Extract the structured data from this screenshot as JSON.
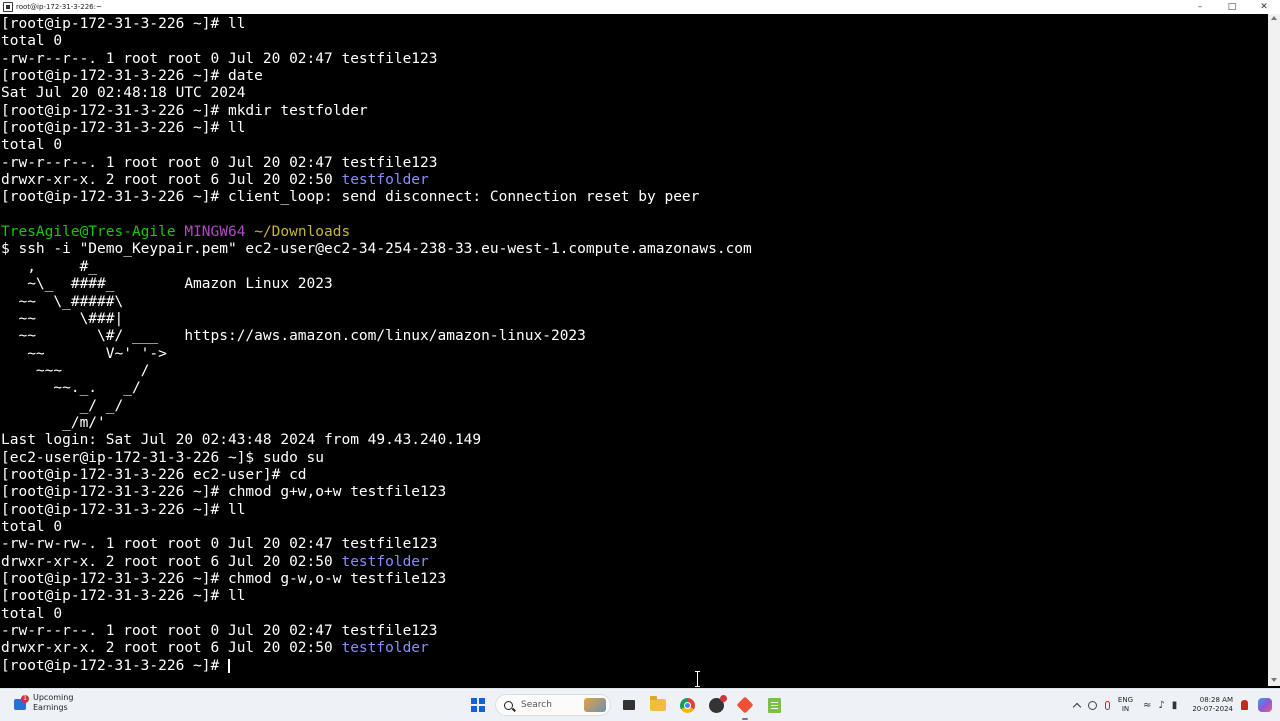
{
  "window": {
    "title": "root@ip-172-31-3-226:~"
  },
  "terminal": {
    "lines": [
      "[root@ip-172-31-3-226 ~]# ll",
      "total 0",
      "-rw-r--r--. 1 root root 0 Jul 20 02:47 testfile123",
      "[root@ip-172-31-3-226 ~]# date",
      "Sat Jul 20 02:48:18 UTC 2024",
      "[root@ip-172-31-3-226 ~]# mkdir testfolder",
      "[root@ip-172-31-3-226 ~]# ll",
      "total 0",
      "-rw-r--r--. 1 root root 0 Jul 20 02:47 testfile123",
      "drwxr-xr-x. 2 root root 6 Jul 20 02:50 ",
      "[root@ip-172-31-3-226 ~]# client_loop: send disconnect: Connection reset by peer",
      "",
      "TresAgile@Tres-Agile",
      "$ ssh -i \"Demo_Keypair.pem\" ec2-user@ec2-34-254-238-33.eu-west-1.compute.amazonaws.com",
      "   ,     #_",
      "   ~\\_  ####_        Amazon Linux 2023",
      "  ~~  \\_#####\\",
      "  ~~     \\###|",
      "  ~~       \\#/ ___   https://aws.amazon.com/linux/amazon-linux-2023",
      "   ~~       V~' '->",
      "    ~~~         /",
      "      ~~._.   _/",
      "         _/ _/",
      "       _/m/'",
      "Last login: Sat Jul 20 02:43:48 2024 from 49.43.240.149",
      "[ec2-user@ip-172-31-3-226 ~]$ sudo su",
      "[root@ip-172-31-3-226 ec2-user]# cd",
      "[root@ip-172-31-3-226 ~]# chmod g+w,o+w testfile123",
      "[root@ip-172-31-3-226 ~]# ll",
      "total 0",
      "-rw-rw-rw-. 1 root root 0 Jul 20 02:47 testfile123",
      "drwxr-xr-x. 2 root root 6 Jul 20 02:50 ",
      "[root@ip-172-31-3-226 ~]# chmod g-w,o-w testfile123",
      "[root@ip-172-31-3-226 ~]# ll",
      "total 0",
      "-rw-r--r--. 1 root root 0 Jul 20 02:47 testfile123",
      "drwxr-xr-x. 2 root root 6 Jul 20 02:50 ",
      "[root@ip-172-31-3-226 ~]# "
    ],
    "dir_name": "testfolder",
    "shell_label": "MINGW64",
    "shell_path": "~/Downloads",
    "colors": {
      "directory": "#8a8cff",
      "user_host": "#16c60c",
      "shell": "#b148c6",
      "path": "#c8b43a",
      "text": "#ffffff",
      "background": "#000000"
    }
  },
  "taskbar": {
    "weather": {
      "line1": "Upcoming",
      "line2": "Earnings",
      "badge": "1"
    },
    "search_label": "Search",
    "lang_top": "ENG",
    "lang_bottom": "IN",
    "time": "08:28 AM",
    "date": "20-07-2024",
    "icons": [
      "start-icon",
      "task-view-icon",
      "file-explorer-icon",
      "chrome-icon",
      "recorder-icon",
      "git-icon",
      "notepad-icon"
    ]
  }
}
